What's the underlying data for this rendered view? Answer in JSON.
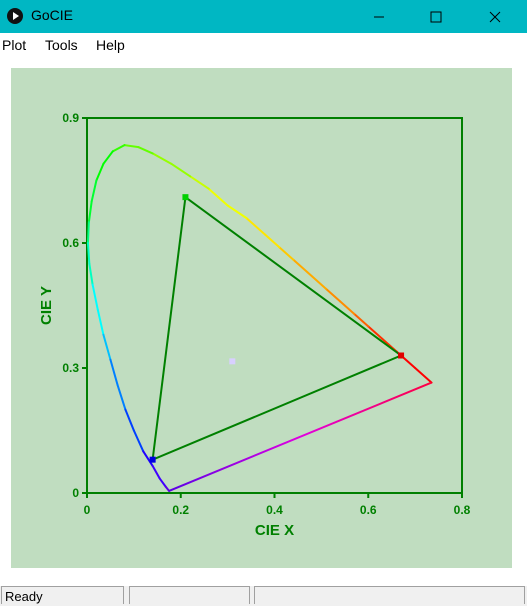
{
  "window": {
    "title": "GoCIE"
  },
  "menu": {
    "items": [
      "Plot",
      "Tools",
      "Help"
    ]
  },
  "chart_data": {
    "type": "scatter",
    "xlabel": "CIE X",
    "ylabel": "CIE Y",
    "xlim": [
      0,
      0.8
    ],
    "ylim": [
      0,
      0.9
    ],
    "xticks": [
      "0",
      "0.2",
      "0.4",
      "0.6",
      "0.8"
    ],
    "yticks": [
      "0",
      "0.3",
      "0.6",
      "0.9"
    ],
    "spectral_locus": [
      [
        0.735,
        0.265
      ],
      [
        0.7,
        0.3
      ],
      [
        0.66,
        0.34
      ],
      [
        0.63,
        0.37
      ],
      [
        0.6,
        0.4
      ],
      [
        0.57,
        0.43
      ],
      [
        0.54,
        0.46
      ],
      [
        0.51,
        0.49
      ],
      [
        0.47,
        0.53
      ],
      [
        0.44,
        0.56
      ],
      [
        0.41,
        0.59
      ],
      [
        0.38,
        0.62
      ],
      [
        0.34,
        0.66
      ],
      [
        0.3,
        0.69
      ],
      [
        0.26,
        0.73
      ],
      [
        0.22,
        0.76
      ],
      [
        0.18,
        0.79
      ],
      [
        0.14,
        0.815
      ],
      [
        0.11,
        0.83
      ],
      [
        0.08,
        0.835
      ],
      [
        0.055,
        0.82
      ],
      [
        0.035,
        0.79
      ],
      [
        0.02,
        0.75
      ],
      [
        0.01,
        0.7
      ],
      [
        0.004,
        0.65
      ],
      [
        0.002,
        0.6
      ],
      [
        0.005,
        0.55
      ],
      [
        0.012,
        0.5
      ],
      [
        0.023,
        0.44
      ],
      [
        0.035,
        0.38
      ],
      [
        0.05,
        0.32
      ],
      [
        0.065,
        0.26
      ],
      [
        0.082,
        0.2
      ],
      [
        0.1,
        0.15
      ],
      [
        0.12,
        0.1
      ],
      [
        0.14,
        0.065
      ],
      [
        0.155,
        0.035
      ],
      [
        0.168,
        0.015
      ],
      [
        0.175,
        0.005
      ]
    ],
    "locus_colors": [
      "#ff0000",
      "#ff3000",
      "#ff6000",
      "#ff8c00",
      "#ffaa00",
      "#ffc800",
      "#ffe600",
      "#f0ff00",
      "#c8ff00",
      "#96ff00",
      "#64ff00",
      "#32ff00",
      "#00ff00",
      "#00ff30",
      "#00ff80",
      "#00ffc0",
      "#00ffff",
      "#00c0ff",
      "#0080ff",
      "#0040ff",
      "#2000ff",
      "#4000ff",
      "#5a00e6"
    ],
    "purple_line": {
      "from": [
        0.175,
        0.005
      ],
      "to": [
        0.735,
        0.265
      ]
    },
    "gamut": [
      {
        "name": "red",
        "x": 0.67,
        "y": 0.33,
        "color": "#e00000"
      },
      {
        "name": "green",
        "x": 0.21,
        "y": 0.71,
        "color": "#00d000"
      },
      {
        "name": "blue",
        "x": 0.14,
        "y": 0.08,
        "color": "#0000e0"
      }
    ],
    "white_point": {
      "x": 0.31,
      "y": 0.316,
      "color": "#d8d0ff"
    },
    "colors": {
      "axis": "#008000",
      "gamut_line": "#008000",
      "background": "#c0ddc0"
    }
  },
  "statusbar": {
    "text": "Ready",
    "cell2": "",
    "cell3": ""
  }
}
